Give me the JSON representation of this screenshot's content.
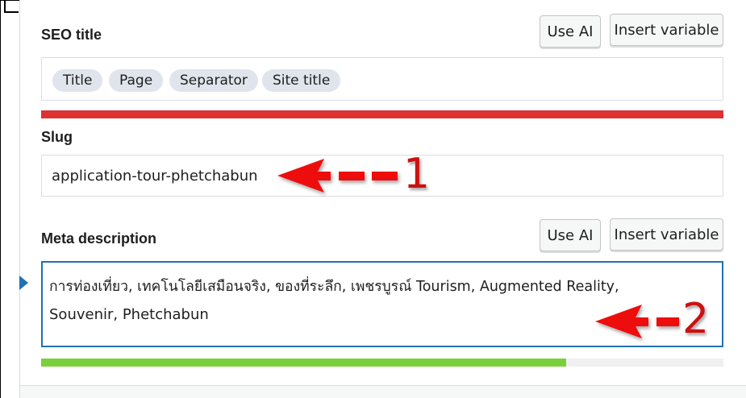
{
  "seo_title": {
    "label": "SEO title",
    "use_ai_label": "Use AI",
    "insert_variable_label": "Insert variable",
    "variables": [
      "Title",
      "Page",
      "Separator",
      "Site title"
    ],
    "progress_fraction": 1.0,
    "progress_color": "#dc3232"
  },
  "slug": {
    "label": "Slug",
    "value": "application-tour-phetchabun"
  },
  "meta_description": {
    "label": "Meta description",
    "use_ai_label": "Use AI",
    "insert_variable_label": "Insert variable",
    "line1": "การท่องเที่ยว, เทคโนโลยีเสมือนจริง, ของที่ระลึก, เพชรบูรณ์ Tourism, Augmented Reality,",
    "line2": "Souvenir, Phetchabun",
    "progress_fraction": 0.77,
    "progress_color": "#7ad03a",
    "focus_color": "#2271b1"
  },
  "annotations": {
    "arrow_1_number": "1",
    "arrow_2_number": "2",
    "arrow_color": "#ee1111"
  }
}
